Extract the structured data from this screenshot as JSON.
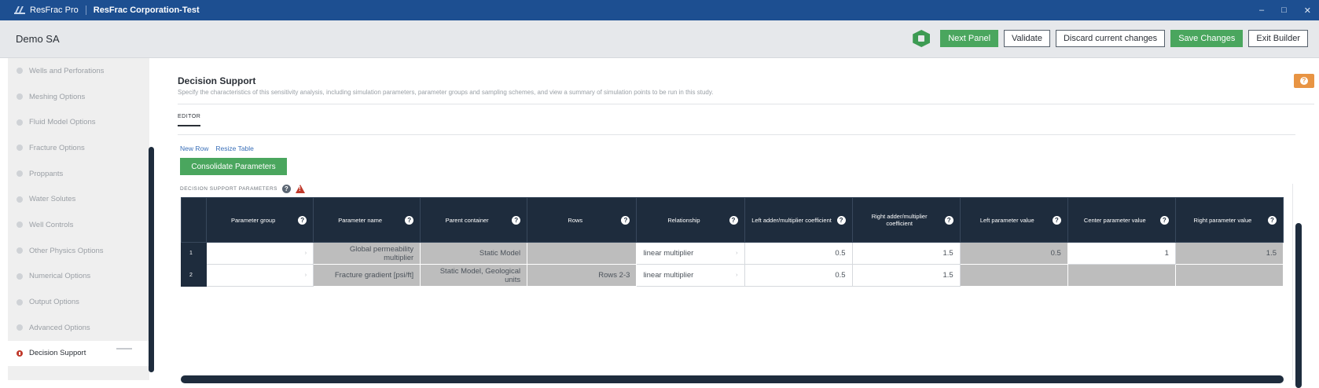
{
  "titlebar": {
    "app_name": "ResFrac Pro",
    "org_name": "ResFrac Corporation-Test",
    "minimize": "–",
    "maximize": "□",
    "close": "✕"
  },
  "header": {
    "project_name": "Demo SA",
    "next_panel": "Next Panel",
    "validate": "Validate",
    "discard": "Discard current changes",
    "save": "Save Changes",
    "exit": "Exit Builder"
  },
  "sidebar": {
    "items": [
      {
        "label": "Wells and Perforations"
      },
      {
        "label": "Meshing Options"
      },
      {
        "label": "Fluid Model Options"
      },
      {
        "label": "Fracture Options"
      },
      {
        "label": "Proppants"
      },
      {
        "label": "Water Solutes"
      },
      {
        "label": "Well Controls"
      },
      {
        "label": "Other Physics Options"
      },
      {
        "label": "Numerical Options"
      },
      {
        "label": "Output Options"
      },
      {
        "label": "Advanced Options"
      },
      {
        "label": "Decision Support"
      }
    ]
  },
  "main": {
    "title": "Decision Support",
    "description": "Specify the characteristics of this sensitivity analysis, including simulation parameters, parameter groups and sampling schemes, and view a summary of simulation points to be run in this study.",
    "tab_editor": "EDITOR",
    "new_row": "New Row",
    "resize_table": "Resize Table",
    "consolidate": "Consolidate Parameters",
    "params_label": "DECISION SUPPORT PARAMETERS",
    "help_glyph": "?"
  },
  "table": {
    "headers": [
      "Parameter group",
      "Parameter name",
      "Parent container",
      "Rows",
      "Relationship",
      "Left adder/multiplier coefficient",
      "Right adder/multiplier coefficient",
      "Left parameter value",
      "Center parameter value",
      "Right parameter value"
    ],
    "rows": [
      {
        "index": "1",
        "group": "",
        "name": "Global permeability multiplier",
        "container": "Static Model",
        "rows": "",
        "relationship": "linear multiplier",
        "left_coef": "0.5",
        "right_coef": "1.5",
        "left_val": "0.5",
        "center_val": "1",
        "right_val": "1.5"
      },
      {
        "index": "2",
        "group": "",
        "name": "Fracture gradient [psi/ft]",
        "container": "Static Model, Geological units",
        "rows": "Rows 2-3",
        "relationship": "linear multiplier",
        "left_coef": "0.5",
        "right_coef": "1.5",
        "left_val": "",
        "center_val": "",
        "right_val": ""
      }
    ],
    "chevron": "›"
  },
  "colors": {
    "titlebar": "#1d4f91",
    "accent_green": "#4aa65e",
    "table_header": "#1e2c3d",
    "error_red": "#c0392b",
    "help_orange": "#e89443"
  }
}
